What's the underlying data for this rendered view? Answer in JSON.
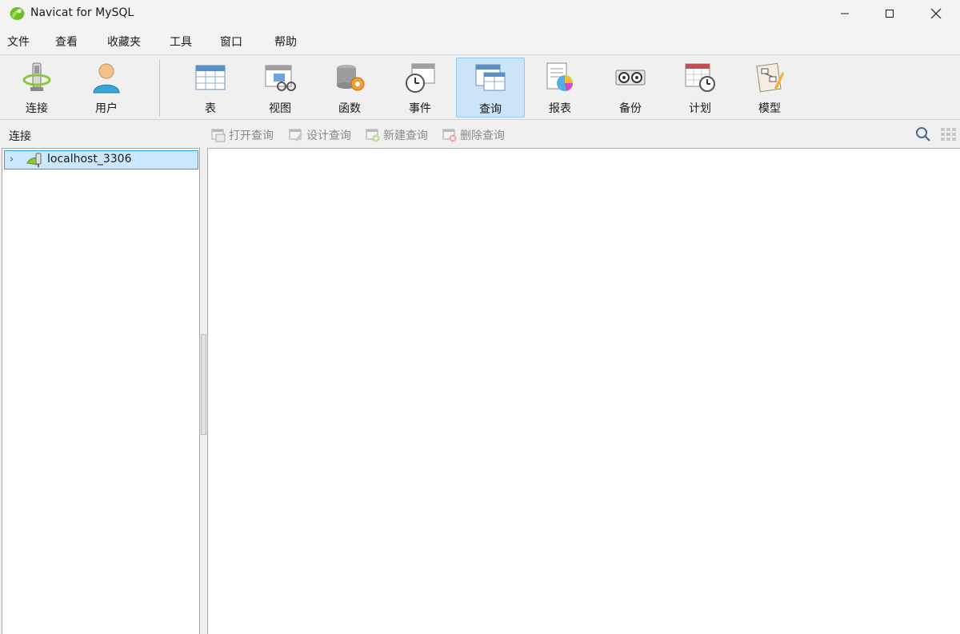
{
  "window": {
    "title": "Navicat for MySQL",
    "controls": [
      "minimize",
      "maximize",
      "close"
    ]
  },
  "menu": [
    "文件",
    "查看",
    "收藏夹",
    "工具",
    "窗口",
    "帮助"
  ],
  "toolbar": {
    "items": [
      {
        "label": "连接",
        "icon": "connection-icon"
      },
      {
        "label": "用户",
        "icon": "user-icon"
      },
      {
        "label": "表",
        "icon": "table-icon"
      },
      {
        "label": "视图",
        "icon": "view-icon"
      },
      {
        "label": "函数",
        "icon": "function-icon"
      },
      {
        "label": "事件",
        "icon": "event-icon"
      },
      {
        "label": "查询",
        "icon": "query-icon",
        "active": true
      },
      {
        "label": "报表",
        "icon": "report-icon"
      },
      {
        "label": "备份",
        "icon": "backup-icon"
      },
      {
        "label": "计划",
        "icon": "schedule-icon"
      },
      {
        "label": "模型",
        "icon": "model-icon"
      }
    ]
  },
  "left_panel": {
    "header": "连接",
    "tree": [
      {
        "label": "localhost_3306",
        "expanded": false,
        "selected": true
      }
    ]
  },
  "query_toolbar": {
    "buttons": [
      "打开查询",
      "设计查询",
      "新建查询",
      "删除查询"
    ]
  },
  "colors": {
    "selection_bg": "#cce8ff",
    "selection_border": "#26a0da",
    "active_tool_bg": "#cce4f7"
  }
}
